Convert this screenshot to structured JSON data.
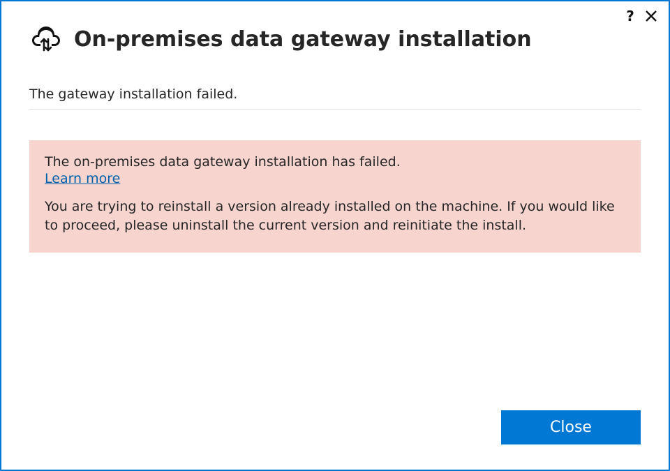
{
  "window": {
    "title": "On-premises data gateway installation"
  },
  "status": {
    "message": "The gateway installation failed."
  },
  "error": {
    "headline": "The on-premises data gateway installation has failed.",
    "learn_more_label": "Learn more",
    "detail": "You are trying to reinstall a version already installed on the machine. If you would like to proceed, please uninstall the current version and reinitiate the install."
  },
  "footer": {
    "close_label": "Close"
  },
  "titlebar": {
    "help_label": "?",
    "close_glyph": "✕"
  }
}
